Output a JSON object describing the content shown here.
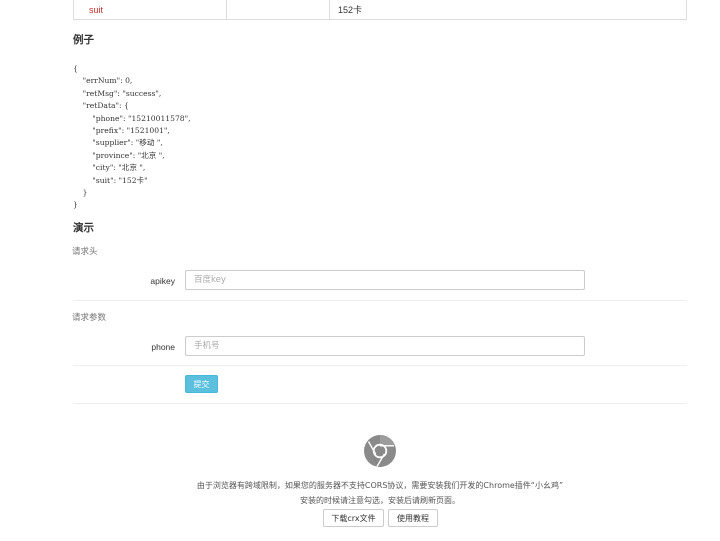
{
  "table": {
    "row": {
      "name": "suit",
      "type": "",
      "desc": "152卡"
    }
  },
  "example": {
    "heading": "例子",
    "code_lines": [
      "{",
      "    \"errNum\": 0,",
      "    \"retMsg\": \"success\",",
      "    \"retData\": {",
      "        \"phone\": \"15210011578\",",
      "        \"prefix\": \"1521001\",",
      "        \"supplier\": \"移动 \",",
      "        \"province\": \"北京 \",",
      "        \"city\": \"北京 \",",
      "        \"suit\": \"152卡\"",
      "    }",
      "}"
    ]
  },
  "demo": {
    "heading": "演示",
    "request_headers_label": "请求头",
    "apikey_label": "apikey",
    "apikey_placeholder": "百度key",
    "request_params_label": "请求参数",
    "phone_label": "phone",
    "phone_placeholder": "手机号",
    "submit_label": "提交"
  },
  "footer": {
    "icon": "chrome-icon",
    "notice_line1": "由于浏览器有跨域限制，如果您的服务器不支持CORS协议，需要安装我们开发的Chrome插件“小幺鸡”",
    "notice_line2": "安装的时候请注意勾选，安装后请刷新页面。",
    "download_label": "下载crx文件",
    "tutorial_label": "使用教程"
  },
  "colors": {
    "accent": "#5bc0de",
    "param_name": "#c9302c"
  }
}
